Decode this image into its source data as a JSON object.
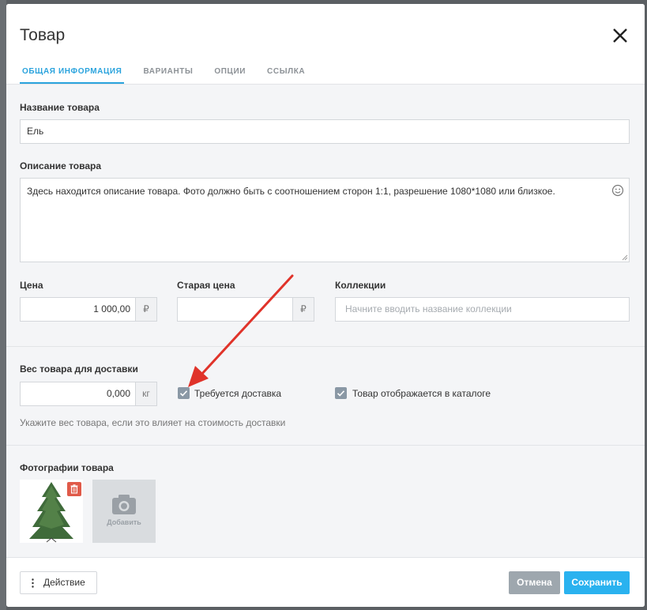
{
  "modal": {
    "title": "Товар",
    "tabs": [
      {
        "label": "ОБЩАЯ ИНФОРМАЦИЯ",
        "active": true
      },
      {
        "label": "ВАРИАНТЫ",
        "active": false
      },
      {
        "label": "ОПЦИИ",
        "active": false
      },
      {
        "label": "ССЫЛКА",
        "active": false
      }
    ]
  },
  "form": {
    "name_label": "Название товара",
    "name_value": "Ель",
    "description_label": "Описание товара",
    "description_value": "Здесь находится описание товара. Фото должно быть с соотношением сторон 1:1, разрешение 1080*1080 или близкое.",
    "price_label": "Цена",
    "price_value": "1 000,00",
    "currency_symbol": "₽",
    "old_price_label": "Старая цена",
    "old_price_value": "",
    "collections_label": "Коллекции",
    "collections_placeholder": "Начните вводить название коллекции",
    "weight_label": "Вес товара для доставки",
    "weight_value": "0,000",
    "weight_unit": "кг",
    "shipping_required_label": "Требуется доставка",
    "shipping_required_checked": true,
    "visible_in_catalog_label": "Товар отображается в каталоге",
    "visible_in_catalog_checked": true,
    "weight_hint": "Укажите вес товара, если это влияет на стоимость доставки",
    "photos_label": "Фотографии товара",
    "add_photo_label": "Добавить"
  },
  "footer": {
    "action_label": "Действие",
    "cancel_label": "Отмена",
    "save_label": "Сохранить"
  },
  "colors": {
    "accent": "#2ab2ef",
    "tab_active": "#2aa3dd",
    "delete": "#e05a49",
    "checkbox": "#8a98a5",
    "annotation_arrow": "#e0332a"
  },
  "icons": {
    "close": "close-icon",
    "emoji": "smiley-icon",
    "trash": "trash-icon",
    "camera": "camera-icon",
    "menu": "vertical-dots-icon",
    "check": "check-icon"
  }
}
